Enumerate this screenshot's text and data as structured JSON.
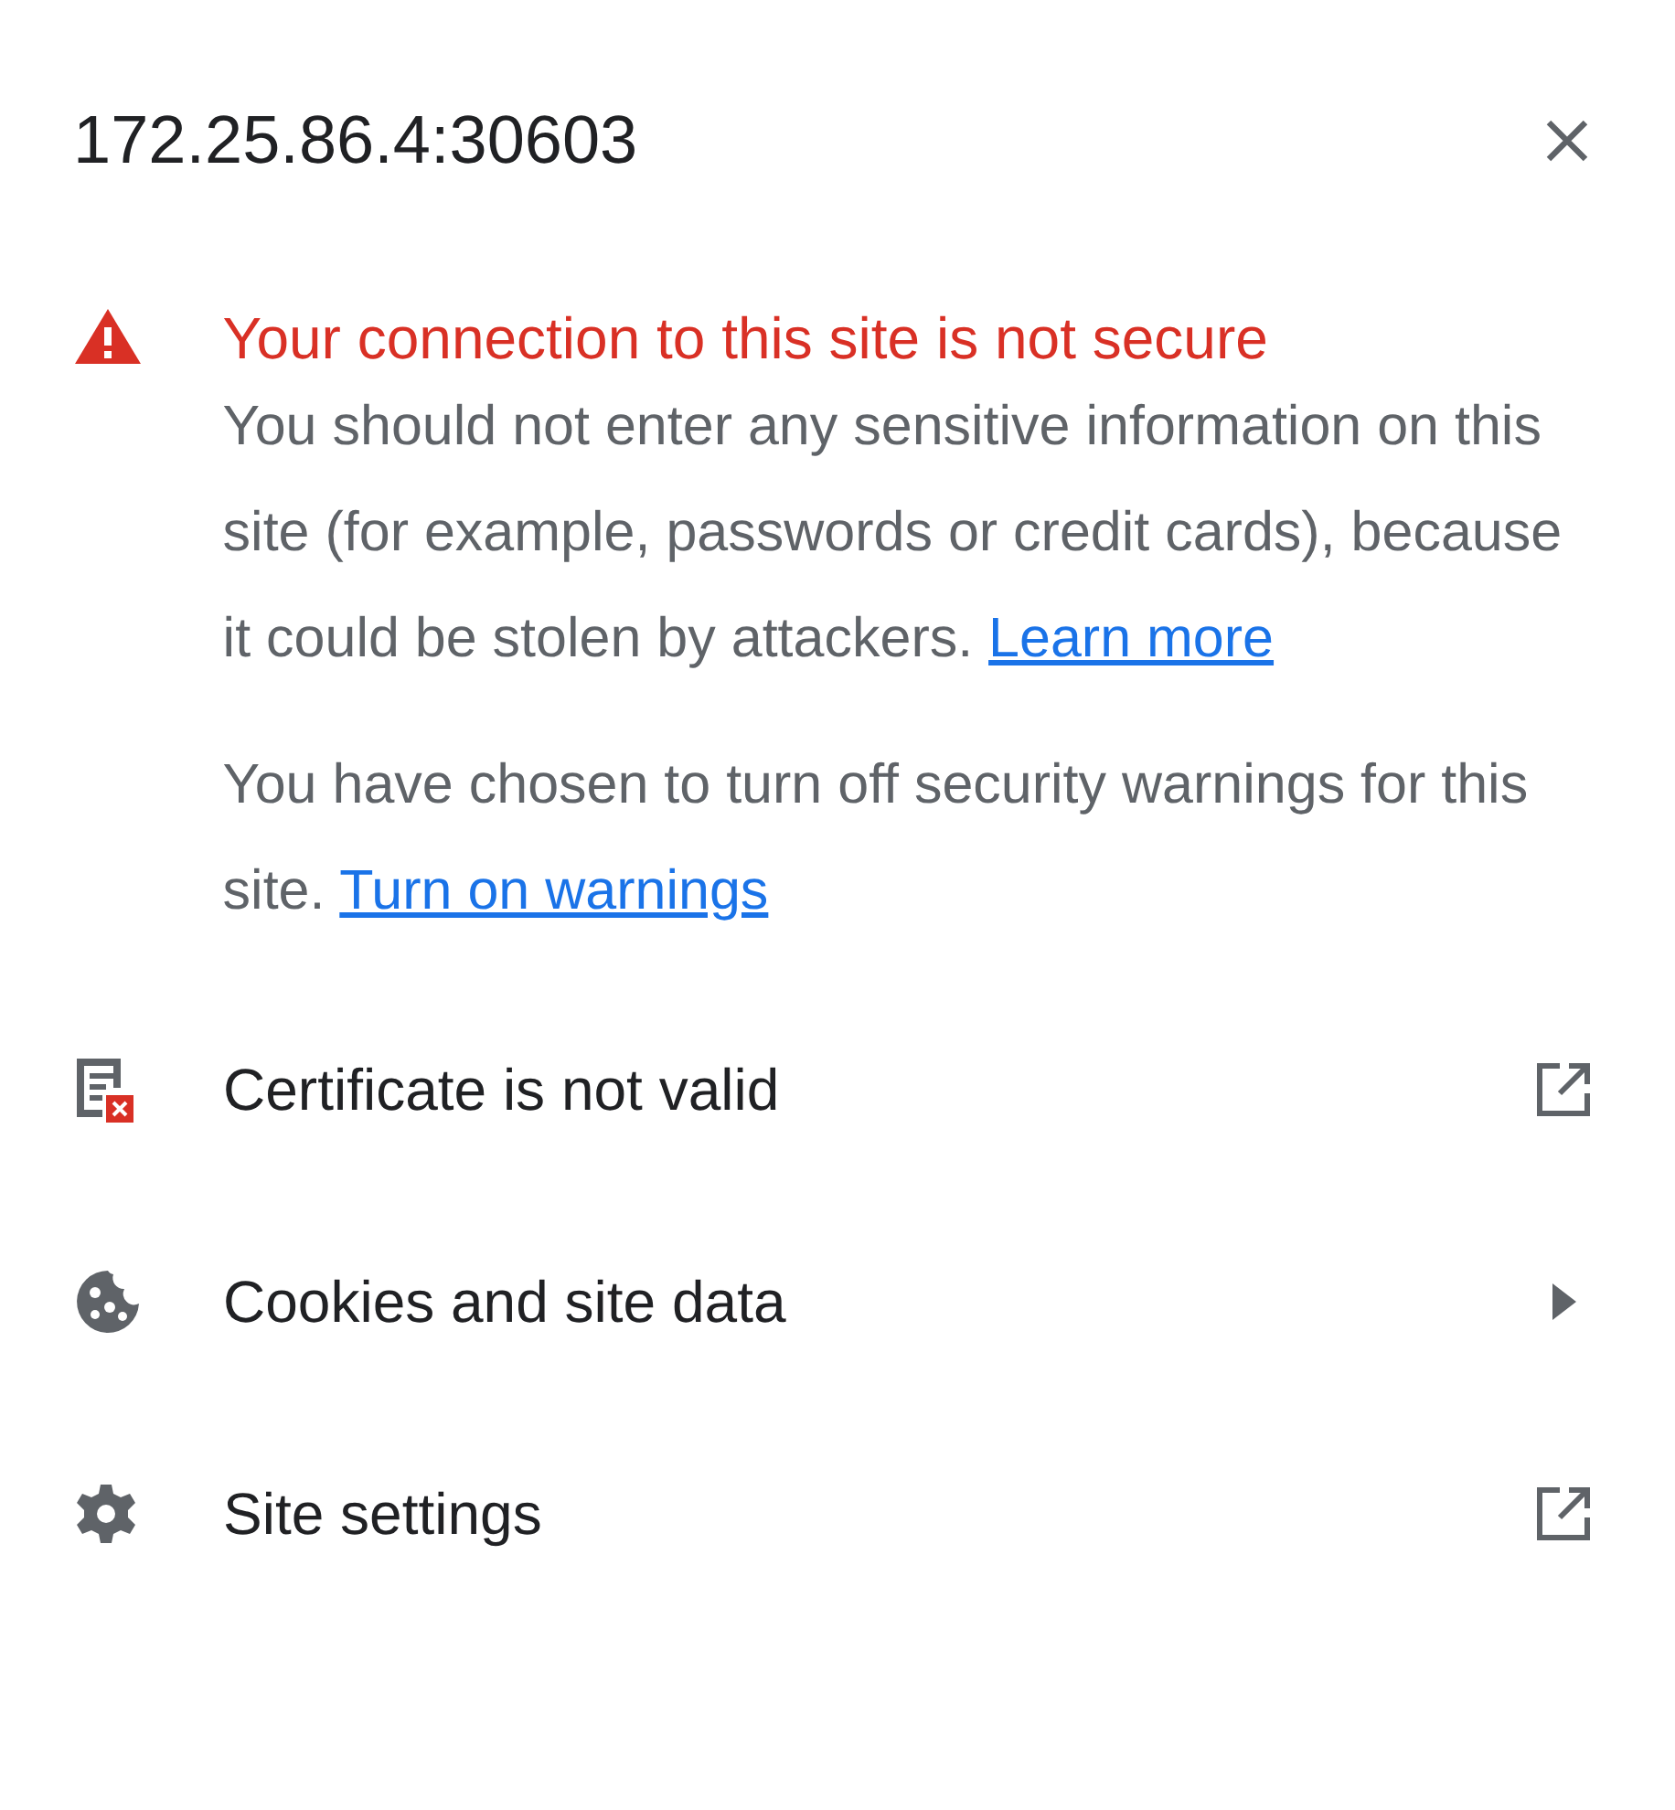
{
  "title": "172.25.86.4:30603",
  "warning": {
    "heading": "Your connection to this site is not secure",
    "paragraphs": [
      {
        "text": "You should not enter any sensitive information on this site (for example, passwords or credit cards), because it could be stolen by attackers.",
        "link": "Learn more"
      },
      {
        "text": "You have chosen to turn off security warnings for this site.",
        "link": "Turn on warnings"
      }
    ]
  },
  "items": [
    {
      "kind": "certificate",
      "label": "Certificate is not valid"
    },
    {
      "kind": "cookies",
      "label": "Cookies and site data"
    },
    {
      "kind": "settings",
      "label": "Site settings"
    }
  ]
}
